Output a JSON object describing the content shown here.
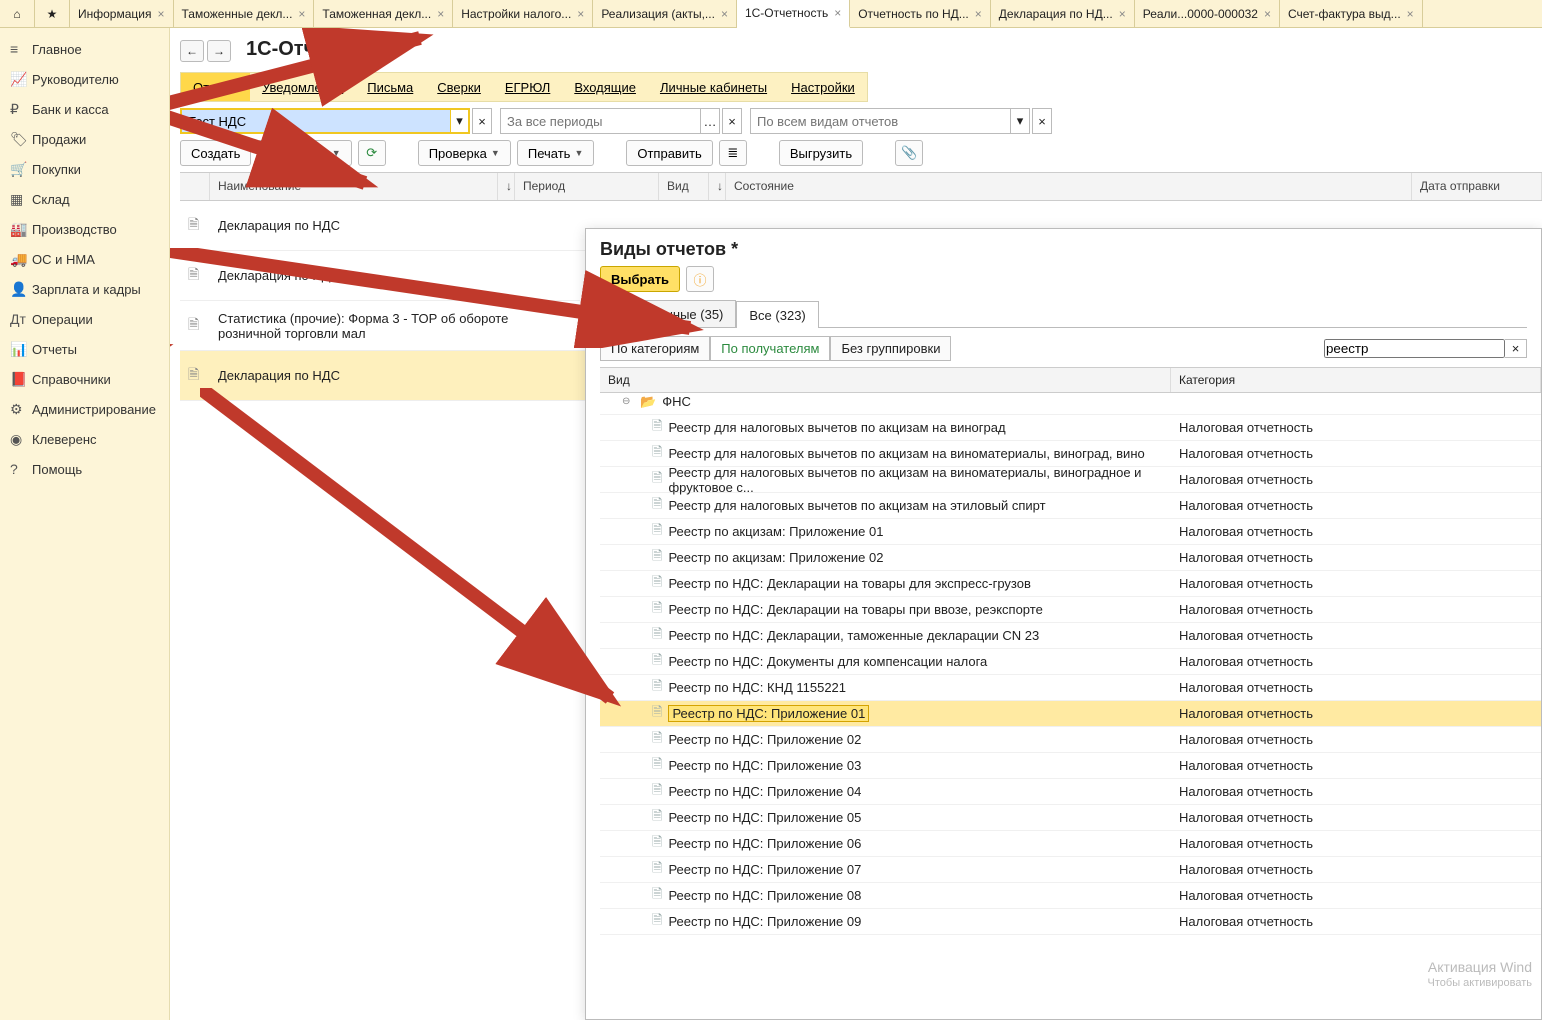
{
  "tabs": [
    {
      "label": "",
      "icon": "⌂"
    },
    {
      "label": "",
      "icon": "★"
    },
    {
      "label": "Информация"
    },
    {
      "label": "Таможенные декл..."
    },
    {
      "label": "Таможенная декл..."
    },
    {
      "label": "Настройки налого..."
    },
    {
      "label": "Реализация (акты,..."
    },
    {
      "label": "1С-Отчетность",
      "active": true
    },
    {
      "label": "Отчетность по НД..."
    },
    {
      "label": "Декларация по НД..."
    },
    {
      "label": "Реали...0000-000032"
    },
    {
      "label": "Счет-фактура выд..."
    }
  ],
  "sidebar": [
    {
      "icon": "≡",
      "label": "Главное"
    },
    {
      "icon": "📈",
      "label": "Руководителю"
    },
    {
      "icon": "₽",
      "label": "Банк и касса"
    },
    {
      "icon": "🏷",
      "label": "Продажи"
    },
    {
      "icon": "🛒",
      "label": "Покупки"
    },
    {
      "icon": "▦",
      "label": "Склад"
    },
    {
      "icon": "🏭",
      "label": "Производство"
    },
    {
      "icon": "🚚",
      "label": "ОС и НМА"
    },
    {
      "icon": "👤",
      "label": "Зарплата и кадры"
    },
    {
      "icon": "Дт",
      "label": "Операции"
    },
    {
      "icon": "📊",
      "label": "Отчеты"
    },
    {
      "icon": "📕",
      "label": "Справочники"
    },
    {
      "icon": "⚙",
      "label": "Администрирование"
    },
    {
      "icon": "◉",
      "label": "Клеверенс"
    },
    {
      "icon": "?",
      "label": "Помощь"
    }
  ],
  "page": {
    "title": "1С-Отчетность"
  },
  "subnav": [
    "Отчеты",
    "Уведомления",
    "Письма",
    "Сверки",
    "ЕГРЮЛ",
    "Входящие",
    "Личные кабинеты",
    "Настройки"
  ],
  "subnavActive": "Отчеты",
  "filter": {
    "value": "Тест НДС",
    "periodPH": "За все периоды",
    "typesPH": "По всем видам отчетов"
  },
  "toolbar": {
    "create": "Создать",
    "load": "Загрузить",
    "check": "Проверка",
    "print": "Печать",
    "send": "Отправить",
    "export": "Выгрузить"
  },
  "gridHead": {
    "name": "Наименование",
    "period": "Период",
    "kind": "Вид",
    "state": "Состояние",
    "sent": "Дата отправки"
  },
  "gridRows": [
    {
      "name": "Декларация по НДС"
    },
    {
      "name": "Декларация по НДС"
    },
    {
      "name": "Статистика (прочие): Форма 3 - ТОР об обороте розничной торговли мал"
    },
    {
      "name": "Декларация по НДС",
      "sel": true
    }
  ],
  "panel": {
    "title": "Виды отчетов *",
    "select": "Выбрать",
    "tabs": {
      "fav": "Избранные (35)",
      "all": "Все (323)"
    },
    "subtabs": {
      "byCat": "По категориям",
      "byRcpt": "По получателям",
      "noGrp": "Без группировки"
    },
    "search": "реестр",
    "head": {
      "kind": "Вид",
      "cat": "Категория"
    },
    "folder": "ФНС",
    "catLabel": "Налоговая отчетность",
    "rows": [
      "Реестр для налоговых вычетов по акцизам на виноград",
      "Реестр для налоговых вычетов по акцизам на виноматериалы, виноград, вино",
      "Реестр для налоговых вычетов по акцизам на виноматериалы, виноградное и фруктовое с...",
      "Реестр для налоговых вычетов по акцизам на этиловый спирт",
      "Реестр по акцизам: Приложение 01",
      "Реестр по акцизам: Приложение 02",
      "Реестр по НДС: Декларации на товары для экспресс-грузов",
      "Реестр по НДС: Декларации на товары при ввозе, реэкспорте",
      "Реестр по НДС: Декларации, таможенные декларации CN 23",
      "Реестр по НДС: Документы для компенсации налога",
      "Реестр по НДС: КНД 1155221",
      "Реестр по НДС: Приложение 01",
      "Реестр по НДС: Приложение 02",
      "Реестр по НДС: Приложение 03",
      "Реестр по НДС: Приложение 04",
      "Реестр по НДС: Приложение 05",
      "Реестр по НДС: Приложение 06",
      "Реестр по НДС: Приложение 07",
      "Реестр по НДС: Приложение 08",
      "Реестр по НДС: Приложение 09"
    ],
    "highlight": 11
  },
  "watermark": {
    "l1": "Активация Wind",
    "l2": "Чтобы активировать"
  }
}
